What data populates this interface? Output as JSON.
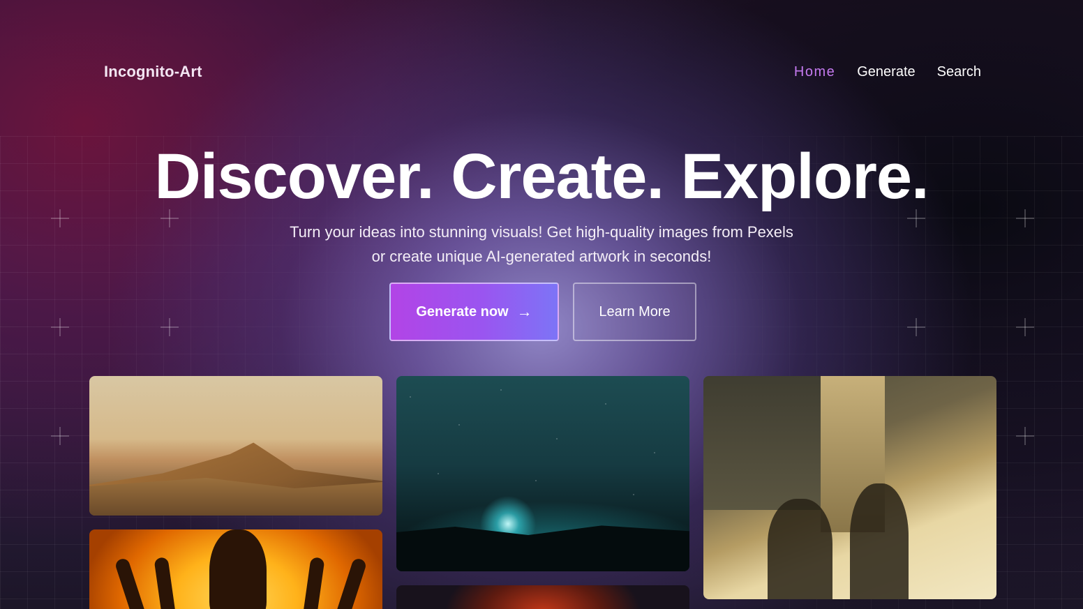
{
  "brand": {
    "name": "Incognito-Art"
  },
  "nav": {
    "items": [
      {
        "label": "Home",
        "active": true
      },
      {
        "label": "Generate",
        "active": false
      },
      {
        "label": "Search",
        "active": false
      }
    ]
  },
  "hero": {
    "title": "Discover. Create. Explore.",
    "subtitle_line1": "Turn your ideas into stunning visuals! Get high-quality images from Pexels",
    "subtitle_line2": "or create unique AI-generated artwork in seconds!",
    "primary_button": {
      "label": "Generate now",
      "icon": "arrow-right-icon"
    },
    "secondary_button": {
      "label": "Learn More"
    }
  },
  "gallery": {
    "images": [
      {
        "subject": "desert dunes at dusk"
      },
      {
        "subject": "person with light under starry night sky"
      },
      {
        "subject": "shadows of two people on sunlit wall"
      },
      {
        "subject": "silhouette with hands against orange light"
      },
      {
        "subject": "red wireframe sphere"
      }
    ]
  },
  "colors": {
    "accent": "#c57af0",
    "button_gradient_start": "#b244e6",
    "button_gradient_end": "#7d74f6"
  }
}
